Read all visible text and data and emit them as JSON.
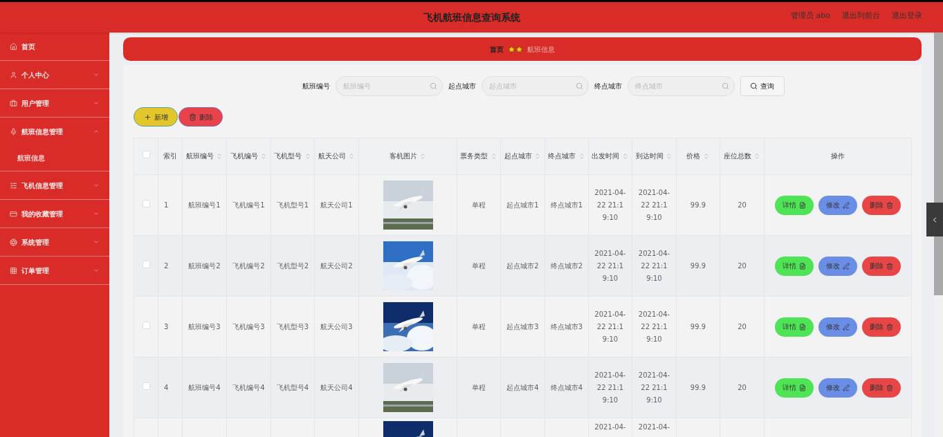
{
  "header": {
    "title": "飞机航班信息查询系统",
    "links": [
      "管理员 abo",
      "退出到前台",
      "退出登录"
    ]
  },
  "sidebar": {
    "items": [
      {
        "label": "首页",
        "kind": "link"
      },
      {
        "label": "个人中心",
        "kind": "menu",
        "expanded": false
      },
      {
        "label": "用户管理",
        "kind": "menu",
        "expanded": false
      },
      {
        "label": "航班信息管理",
        "kind": "menu",
        "expanded": true,
        "children": [
          {
            "label": "航班信息",
            "selected": true
          }
        ]
      },
      {
        "label": "飞机信息管理",
        "kind": "menu",
        "expanded": false
      },
      {
        "label": "我的收藏管理",
        "kind": "menu",
        "expanded": false
      },
      {
        "label": "系统管理",
        "kind": "menu",
        "expanded": false
      },
      {
        "label": "订单管理",
        "kind": "menu",
        "expanded": false
      }
    ]
  },
  "breadcrumb": [
    {
      "label": "首页",
      "current": false
    },
    {
      "label": "航班信息",
      "current": true
    }
  ],
  "search": {
    "fields": [
      {
        "label": "航班编号",
        "placeholder": "航班编号"
      },
      {
        "label": "起点城市",
        "placeholder": "起点城市"
      },
      {
        "label": "终点城市",
        "placeholder": "终点城市"
      }
    ],
    "button": "查询"
  },
  "toolbar": [
    {
      "label": "新增",
      "kind": "add"
    },
    {
      "label": "删除",
      "kind": "delete"
    }
  ],
  "table": {
    "header_checked": false,
    "columns": [
      {
        "kind": "checkbox"
      },
      {
        "kind": "text",
        "label": "索引",
        "sortable": false
      },
      {
        "kind": "text",
        "label": "航班编号",
        "sortable": true
      },
      {
        "kind": "text",
        "label": "飞机编号",
        "sortable": true
      },
      {
        "kind": "text",
        "label": "飞机型号",
        "sortable": true
      },
      {
        "kind": "text",
        "label": "航天公司",
        "sortable": true
      },
      {
        "kind": "picture",
        "label": "客机图片",
        "sortable": true
      },
      {
        "kind": "text",
        "label": "票务类型",
        "sortable": true
      },
      {
        "kind": "text",
        "label": "起点城市",
        "sortable": true
      },
      {
        "kind": "text",
        "label": "终点城市",
        "sortable": true
      },
      {
        "kind": "time",
        "label": "出发时间",
        "sortable": true
      },
      {
        "kind": "time",
        "label": "到达时间",
        "sortable": true
      },
      {
        "kind": "text",
        "label": "价格",
        "sortable": true
      },
      {
        "kind": "text",
        "label": "座位总数",
        "sortable": true
      },
      {
        "kind": "actions",
        "label": "操作",
        "sortable": false
      }
    ],
    "rows": [
      {
        "checked": false,
        "cells": [
          "",
          "1",
          "航班编号1",
          "飞机编号1",
          "飞机型号1",
          "航天公司1",
          "",
          "单程",
          "起点城市1",
          "终点城市1",
          "2021-04-22 21:19:10",
          "2021-04-22 21:19:10",
          "99.9",
          "20",
          ""
        ],
        "actions": [
          {
            "label": "详情",
            "kind": "detail"
          },
          {
            "label": "修改",
            "kind": "edit"
          },
          {
            "label": "删除",
            "kind": "delete"
          }
        ]
      },
      {
        "checked": false,
        "cells": [
          "",
          "2",
          "航班编号2",
          "飞机编号2",
          "飞机型号2",
          "航天公司2",
          "",
          "单程",
          "起点城市2",
          "终点城市2",
          "2021-04-22 21:19:10",
          "2021-04-22 21:19:10",
          "99.9",
          "20",
          ""
        ],
        "actions": [
          {
            "label": "详情",
            "kind": "detail"
          },
          {
            "label": "修改",
            "kind": "edit"
          },
          {
            "label": "删除",
            "kind": "delete"
          }
        ]
      },
      {
        "checked": false,
        "cells": [
          "",
          "3",
          "航班编号3",
          "飞机编号3",
          "飞机型号3",
          "航天公司3",
          "",
          "单程",
          "起点城市3",
          "终点城市3",
          "2021-04-22 21:19:10",
          "2021-04-22 21:19:10",
          "99.9",
          "20",
          ""
        ],
        "actions": [
          {
            "label": "详情",
            "kind": "detail"
          },
          {
            "label": "修改",
            "kind": "edit"
          },
          {
            "label": "删除",
            "kind": "delete"
          }
        ]
      },
      {
        "checked": false,
        "cells": [
          "",
          "4",
          "航班编号4",
          "飞机编号4",
          "飞机型号4",
          "航天公司4",
          "",
          "单程",
          "起点城市4",
          "终点城市4",
          "2021-04-22 21:19:10",
          "2021-04-22 21:19:10",
          "99.9",
          "20",
          ""
        ],
        "actions": [
          {
            "label": "详情",
            "kind": "detail"
          },
          {
            "label": "修改",
            "kind": "edit"
          },
          {
            "label": "删除",
            "kind": "delete"
          }
        ]
      },
      {
        "cells": [
          "",
          "",
          "",
          "",
          "",
          "",
          "",
          "",
          "",
          "",
          "2021-04-",
          "2021-04-",
          "",
          "",
          ""
        ]
      }
    ]
  }
}
